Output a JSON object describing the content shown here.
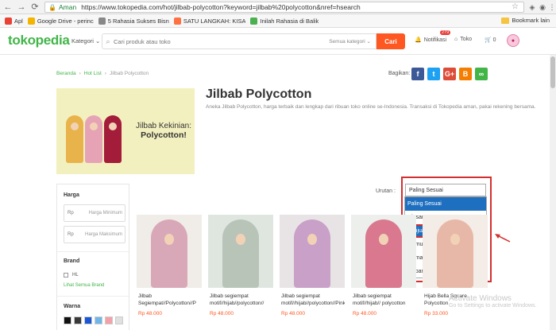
{
  "browser": {
    "secure_label": "Aman",
    "url": "https://www.tokopedia.com/hot/jilbab-polycotton?keyword=jilbab%20polycotton&nref=hsearch",
    "bookmarks": [
      {
        "label": "Apl",
        "color": "#e94235"
      },
      {
        "label": "Google Drive - perinc",
        "color": "#f4b400"
      },
      {
        "label": "5 Rahasia Sukses Bisn",
        "color": "#888888"
      },
      {
        "label": "SATU LANGKAH: KISA",
        "color": "#ff7043"
      },
      {
        "label": "Inilah Rahasia di Balik",
        "color": "#4caf50"
      }
    ],
    "bookmark_folder": "Bookmark lain"
  },
  "header": {
    "logo": "tokopedia",
    "kategori": "Kategori",
    "search_placeholder": "Cari produk atau toko",
    "search_scope": "Semua kategori",
    "search_button": "Cari",
    "notif_label": "Notifikasi",
    "notif_count": "279",
    "toko_label": "Toko",
    "cart_count": "0"
  },
  "breadcrumb": {
    "items": [
      "Beranda",
      "Hot List",
      "Jilbab Polycotton"
    ],
    "sep": "›"
  },
  "share": {
    "label": "Bagikan:",
    "buttons": [
      {
        "glyph": "f",
        "color": "#3b5998"
      },
      {
        "glyph": "t",
        "color": "#1da1f2"
      },
      {
        "glyph": "G+",
        "color": "#dd4b39"
      },
      {
        "glyph": "B",
        "color": "#f57d00"
      },
      {
        "glyph": "∞",
        "color": "#42b549"
      }
    ]
  },
  "banner": {
    "line1": "Jilbab Kekinian:",
    "line2": "Polycotton!"
  },
  "page": {
    "title": "Jilbab Polycotton",
    "description": "Aneka Jilbab Polycotton, harga terbaik dan lengkap dari ribuan toko online se-Indonesia. Transaksi di Tokopedia aman, pakai rekening bersama."
  },
  "filters": {
    "harga_title": "Harga",
    "min_prefix": "Rp",
    "min_placeholder": "Harga Minimum",
    "max_prefix": "Rp",
    "max_placeholder": "Harga Maksimum",
    "brand_title": "Brand",
    "brand_option": "HL",
    "see_all_brand": "Lihat Semua Brand",
    "warna_title": "Warna",
    "colors": [
      "#111111",
      "#3a3a3a",
      "#1a56d6",
      "#6fb7e8",
      "#f4a0a8",
      "#e0e0e0"
    ]
  },
  "sort": {
    "label": "Urutan :",
    "selected": "Paling Sesuai",
    "options": [
      "Paling Sesuai",
      "Ulasan",
      "Penjualan",
      "Termurah",
      "Termahal",
      "Terbaru"
    ]
  },
  "products": [
    {
      "name": "Jilbab Segiempat//Polycotton//P",
      "price": "Rp 48.000",
      "bg": "#f0ece8",
      "scarf": "#d9a8b8"
    },
    {
      "name": "Jilbab segiempat motif//hijab//polycotton//",
      "price": "Rp 48.000",
      "bg": "#dfe6e0",
      "scarf": "#b9c4b8"
    },
    {
      "name": "Jilbab segiempat motif//hijab//polycotton//Pink//S",
      "price": "Rp 48.000",
      "bg": "#e8e4e6",
      "scarf": "#c9a0c8"
    },
    {
      "name": "Jilbab segiempat motif//hijab// polycotton",
      "price": "Rp 48.000",
      "bg": "#ecefec",
      "scarf": "#d9788e"
    },
    {
      "name": "Hijab Bella Square Polycotton",
      "price": "Rp 33.000",
      "bg": "#f4ece6",
      "scarf": "#e7b8a8"
    }
  ],
  "watermark": {
    "line1": "Activate Windows",
    "line2": "Go to Settings to activate Windows."
  }
}
